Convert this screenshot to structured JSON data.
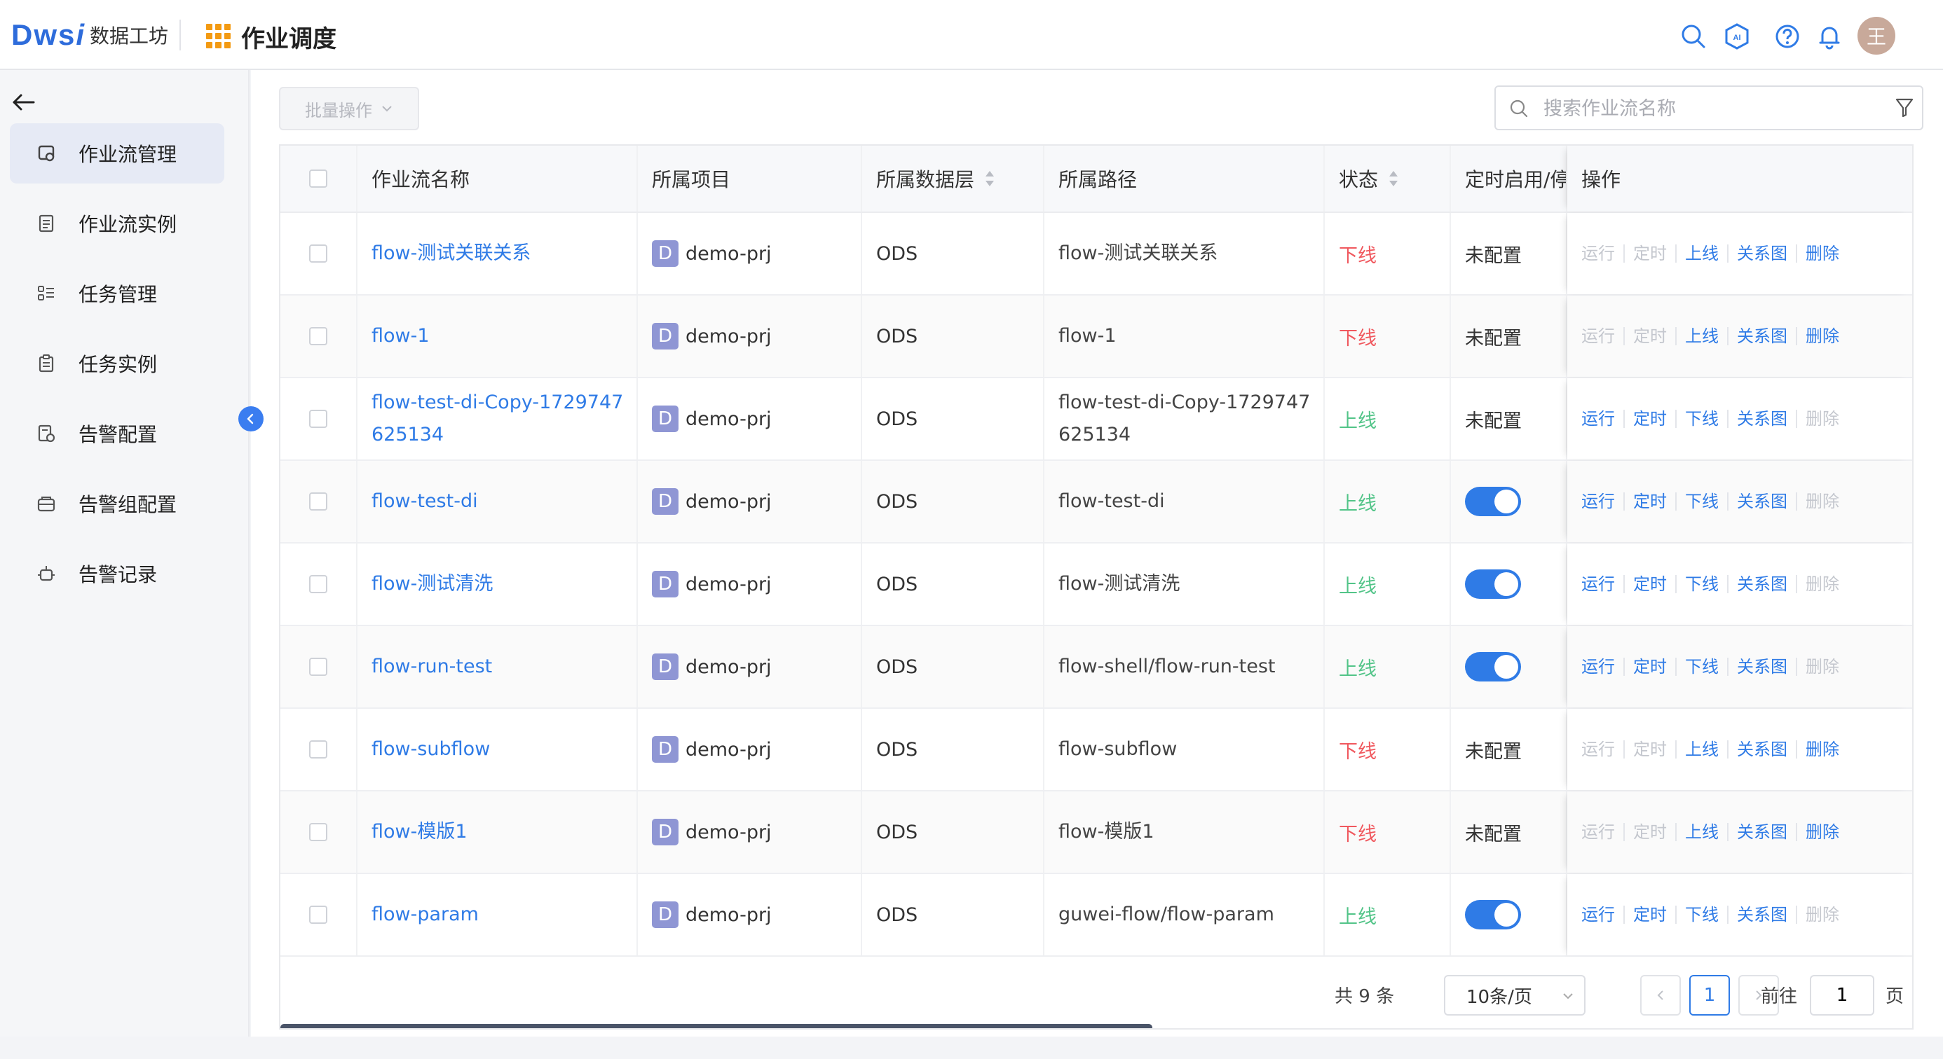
{
  "brand": {
    "mark_left": "Dws",
    "mark_right": "i",
    "name": "数据工坊"
  },
  "header": {
    "title": "作业调度"
  },
  "user": {
    "avatar_text": "王"
  },
  "sidebar": {
    "items": [
      {
        "label": "作业流管理",
        "icon": "workflow-icon",
        "active": true
      },
      {
        "label": "作业流实例",
        "icon": "document-icon"
      },
      {
        "label": "任务管理",
        "icon": "list-icon"
      },
      {
        "label": "任务实例",
        "icon": "clipboard-icon"
      },
      {
        "label": "告警配置",
        "icon": "alert-settings-icon"
      },
      {
        "label": "告警组配置",
        "icon": "alert-group-icon"
      },
      {
        "label": "告警记录",
        "icon": "alarm-record-icon"
      }
    ]
  },
  "toolbar": {
    "batch_label": "批量操作",
    "search_placeholder": "搜索作业流名称",
    "search_value": ""
  },
  "table": {
    "columns": [
      "作业流名称",
      "所属项目",
      "所属数据层",
      "所属路径",
      "状态",
      "定时启用/停",
      "操作"
    ],
    "rows": [
      {
        "name": "flow-测试关联关系",
        "project": "demo-prj",
        "badge": "D",
        "layer": "ODS",
        "path": "flow-测试关联关系",
        "status": "下线",
        "schedule": "未配置",
        "ops": [
          {
            "label": "运行",
            "enabled": false
          },
          {
            "label": "定时",
            "enabled": false
          },
          {
            "label": "上线",
            "enabled": true
          },
          {
            "label": "关系图",
            "enabled": true
          },
          {
            "label": "删除",
            "enabled": true
          }
        ]
      },
      {
        "name": "flow-1",
        "project": "demo-prj",
        "badge": "D",
        "layer": "ODS",
        "path": "flow-1",
        "status": "下线",
        "schedule": "未配置",
        "ops": [
          {
            "label": "运行",
            "enabled": false
          },
          {
            "label": "定时",
            "enabled": false
          },
          {
            "label": "上线",
            "enabled": true
          },
          {
            "label": "关系图",
            "enabled": true
          },
          {
            "label": "删除",
            "enabled": true
          }
        ]
      },
      {
        "name": "flow-test-di-Copy-1729747625134",
        "project": "demo-prj",
        "badge": "D",
        "layer": "ODS",
        "path": "flow-test-di-Copy-1729747625134",
        "status": "上线",
        "schedule": "未配置",
        "ops": [
          {
            "label": "运行",
            "enabled": true
          },
          {
            "label": "定时",
            "enabled": true
          },
          {
            "label": "下线",
            "enabled": true
          },
          {
            "label": "关系图",
            "enabled": true
          },
          {
            "label": "删除",
            "enabled": false
          }
        ]
      },
      {
        "name": "flow-test-di",
        "project": "demo-prj",
        "badge": "D",
        "layer": "ODS",
        "path": "flow-test-di",
        "status": "上线",
        "schedule": "toggle",
        "ops": [
          {
            "label": "运行",
            "enabled": true
          },
          {
            "label": "定时",
            "enabled": true
          },
          {
            "label": "下线",
            "enabled": true
          },
          {
            "label": "关系图",
            "enabled": true
          },
          {
            "label": "删除",
            "enabled": false
          }
        ]
      },
      {
        "name": "flow-测试清洗",
        "project": "demo-prj",
        "badge": "D",
        "layer": "ODS",
        "path": "flow-测试清洗",
        "status": "上线",
        "schedule": "toggle",
        "ops": [
          {
            "label": "运行",
            "enabled": true
          },
          {
            "label": "定时",
            "enabled": true
          },
          {
            "label": "下线",
            "enabled": true
          },
          {
            "label": "关系图",
            "enabled": true
          },
          {
            "label": "删除",
            "enabled": false
          }
        ]
      },
      {
        "name": "flow-run-test",
        "project": "demo-prj",
        "badge": "D",
        "layer": "ODS",
        "path": "flow-shell/flow-run-test",
        "status": "上线",
        "schedule": "toggle",
        "ops": [
          {
            "label": "运行",
            "enabled": true
          },
          {
            "label": "定时",
            "enabled": true
          },
          {
            "label": "下线",
            "enabled": true
          },
          {
            "label": "关系图",
            "enabled": true
          },
          {
            "label": "删除",
            "enabled": false
          }
        ]
      },
      {
        "name": "flow-subflow",
        "project": "demo-prj",
        "badge": "D",
        "layer": "ODS",
        "path": "flow-subflow",
        "status": "下线",
        "schedule": "未配置",
        "ops": [
          {
            "label": "运行",
            "enabled": false
          },
          {
            "label": "定时",
            "enabled": false
          },
          {
            "label": "上线",
            "enabled": true
          },
          {
            "label": "关系图",
            "enabled": true
          },
          {
            "label": "删除",
            "enabled": true
          }
        ]
      },
      {
        "name": "flow-模版1",
        "project": "demo-prj",
        "badge": "D",
        "layer": "ODS",
        "path": "flow-模版1",
        "status": "下线",
        "schedule": "未配置",
        "ops": [
          {
            "label": "运行",
            "enabled": false
          },
          {
            "label": "定时",
            "enabled": false
          },
          {
            "label": "上线",
            "enabled": true
          },
          {
            "label": "关系图",
            "enabled": true
          },
          {
            "label": "删除",
            "enabled": true
          }
        ]
      },
      {
        "name": "flow-param",
        "project": "demo-prj",
        "badge": "D",
        "layer": "ODS",
        "path": "guwei-flow/flow-param",
        "status": "上线",
        "schedule": "toggle",
        "ops": [
          {
            "label": "运行",
            "enabled": true
          },
          {
            "label": "定时",
            "enabled": true
          },
          {
            "label": "下线",
            "enabled": true
          },
          {
            "label": "关系图",
            "enabled": true
          },
          {
            "label": "删除",
            "enabled": false
          }
        ]
      }
    ]
  },
  "pagination": {
    "total_text": "共 9 条",
    "page_size": "10条/页",
    "current_page": "1",
    "goto_label": "前往",
    "goto_value": "1",
    "page_unit": "页"
  },
  "colors": {
    "accent": "#2f7be6",
    "offline": "#f0585e",
    "online": "#52c488",
    "badge": "#8f96d4",
    "logo_orange": "#f39a12"
  }
}
